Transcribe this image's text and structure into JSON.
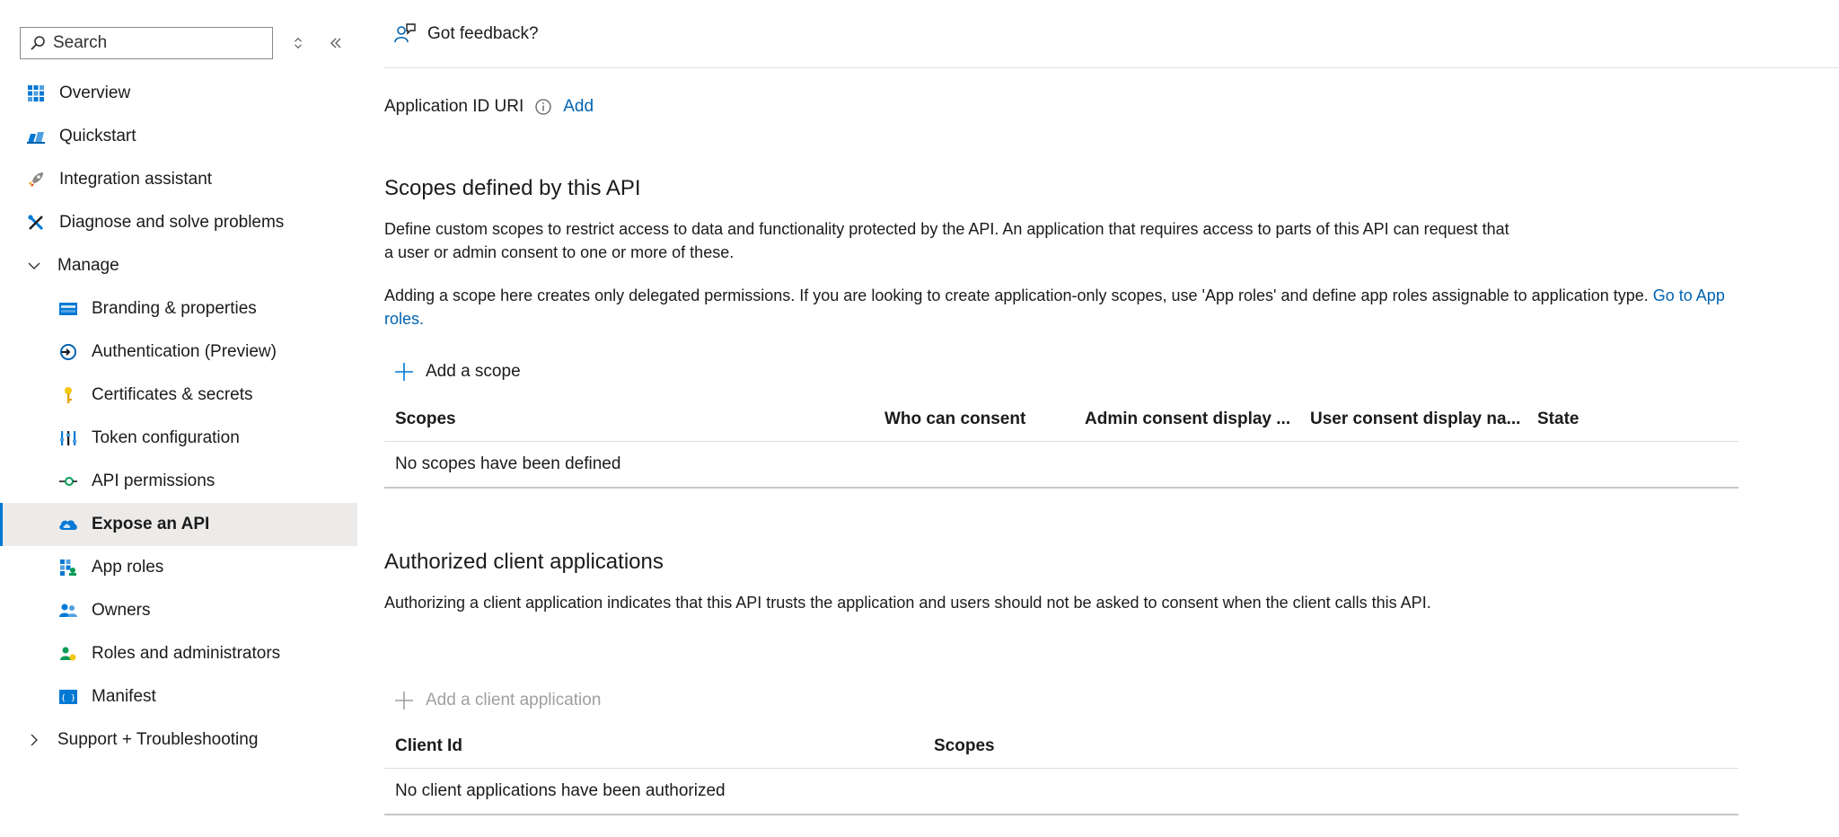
{
  "sidebar": {
    "search_placeholder": "Search",
    "items": [
      {
        "label": "Overview",
        "icon": "overview-icon"
      },
      {
        "label": "Quickstart",
        "icon": "quickstart-icon"
      },
      {
        "label": "Integration assistant",
        "icon": "rocket-icon"
      },
      {
        "label": "Diagnose and solve problems",
        "icon": "wrench-icon"
      },
      {
        "label": "Manage",
        "icon": "chevron-down-icon"
      },
      {
        "label": "Branding & properties",
        "icon": "branding-icon"
      },
      {
        "label": "Authentication (Preview)",
        "icon": "authentication-icon"
      },
      {
        "label": "Certificates & secrets",
        "icon": "key-icon"
      },
      {
        "label": "Token configuration",
        "icon": "token-bars-icon"
      },
      {
        "label": "API permissions",
        "icon": "api-permissions-icon"
      },
      {
        "label": "Expose an API",
        "icon": "cloud-icon"
      },
      {
        "label": "App roles",
        "icon": "app-roles-icon"
      },
      {
        "label": "Owners",
        "icon": "owners-icon"
      },
      {
        "label": "Roles and administrators",
        "icon": "roles-admin-icon"
      },
      {
        "label": "Manifest",
        "icon": "manifest-icon"
      },
      {
        "label": "Support + Troubleshooting",
        "icon": "chevron-right-icon"
      }
    ]
  },
  "header": {
    "feedback_label": "Got feedback?"
  },
  "app_id": {
    "label": "Application ID URI",
    "add_label": "Add"
  },
  "scopes": {
    "title": "Scopes defined by this API",
    "description": "Define custom scopes to restrict access to data and functionality protected by the API. An application that requires access to parts of this API can request that a user or admin consent to one or more of these.",
    "note_text": "Adding a scope here creates only delegated permissions. If you are looking to create application-only scopes, use 'App roles' and define app roles assignable to application type.",
    "note_link": "Go to App roles.",
    "add_label": "Add a scope",
    "columns": [
      "Scopes",
      "Who can consent",
      "Admin consent display ...",
      "User consent display na...",
      "State"
    ],
    "empty": "No scopes have been defined"
  },
  "clients": {
    "title": "Authorized client applications",
    "description": "Authorizing a client application indicates that this API trusts the application and users should not be asked to consent when the client calls this API.",
    "add_label": "Add a client application",
    "columns": [
      "Client Id",
      "Scopes"
    ],
    "empty": "No client applications have been authorized"
  },
  "colors": {
    "accent": "#0078d4",
    "link": "#0063b1",
    "selected_bg": "#edebe9",
    "disabled": "#a19f9d"
  }
}
